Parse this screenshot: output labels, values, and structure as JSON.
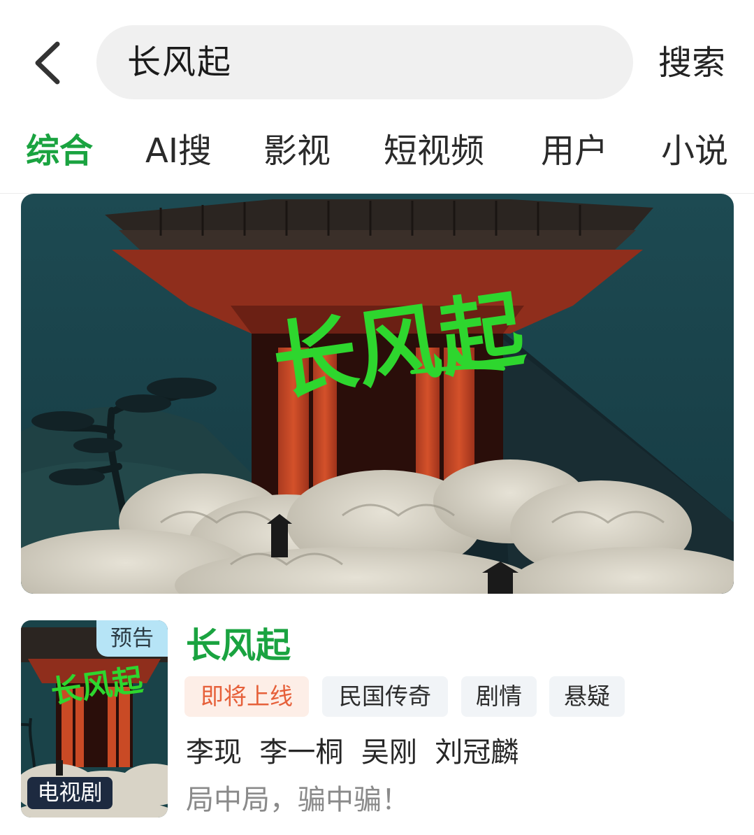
{
  "search": {
    "query": "长风起",
    "submit_label": "搜索"
  },
  "tabs": [
    {
      "label": "综合",
      "active": true
    },
    {
      "label": "AI搜",
      "active": false
    },
    {
      "label": "影视",
      "active": false
    },
    {
      "label": "短视频",
      "active": false
    },
    {
      "label": "用户",
      "active": false
    },
    {
      "label": "小说",
      "active": false
    }
  ],
  "banner": {
    "calligraphy_text": "长风起"
  },
  "result": {
    "title": "长风起",
    "preview_badge": "预告",
    "type_badge": "电视剧",
    "tags": [
      {
        "label": "即将上线",
        "kind": "status"
      },
      {
        "label": "民国传奇",
        "kind": "genre"
      },
      {
        "label": "剧情",
        "kind": "genre"
      },
      {
        "label": "悬疑",
        "kind": "genre"
      }
    ],
    "cast": [
      "李现",
      "李一桐",
      "吴刚",
      "刘冠麟"
    ],
    "cast_line": "李现  李一桐  吴刚  刘冠麟",
    "tagline": "局中局，骗中骗！"
  },
  "colors": {
    "accent_green": "#1aa340",
    "status_orange": "#e6603a",
    "status_bg": "#fdeee7",
    "tag_bg": "#f1f4f7",
    "preview_badge_bg": "#b6e4f6",
    "type_badge_bg": "#1d2a40"
  },
  "icons": {
    "back": "chevron-left-icon"
  }
}
